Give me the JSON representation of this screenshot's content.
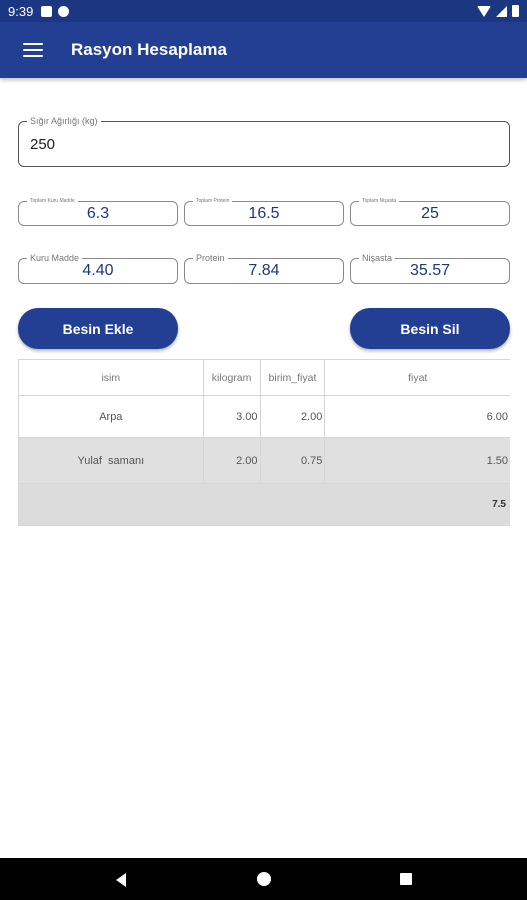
{
  "status_bar": {
    "time": "9:39"
  },
  "app_bar": {
    "title": "Rasyon Hesaplama"
  },
  "weight": {
    "label": "Sığır Ağırlığı (kg)",
    "value": "250"
  },
  "requirements": [
    {
      "label": "Toplam Kuru Madde",
      "value": "6.3"
    },
    {
      "label": "Toplam Protein",
      "value": "16.5"
    },
    {
      "label": "Toplam Nişasta",
      "value": "25"
    }
  ],
  "computed": [
    {
      "label": "Kuru Madde",
      "value": "4.40"
    },
    {
      "label": "Protein",
      "value": "7.84"
    },
    {
      "label": "Nişasta",
      "value": "35.57"
    }
  ],
  "buttons": {
    "add": "Besin Ekle",
    "remove": "Besin Sil"
  },
  "table": {
    "headers": [
      "isim",
      "kilogram",
      "birim_fiyat",
      "fiyat"
    ],
    "rows": [
      [
        "Arpa",
        "3.00",
        "2.00",
        "6.00"
      ],
      [
        "Yulaf  samanı",
        "2.00",
        "0.75",
        "1.50"
      ]
    ],
    "total": "7.5"
  },
  "icons": {
    "menu": "hamburger-menu-icon",
    "back": "back-triangle-icon",
    "home": "home-circle-icon",
    "recent": "recent-apps-square-icon"
  },
  "colors": {
    "primary": "#223f93",
    "status_bar": "#1c3782",
    "value_text": "#1c3782"
  }
}
